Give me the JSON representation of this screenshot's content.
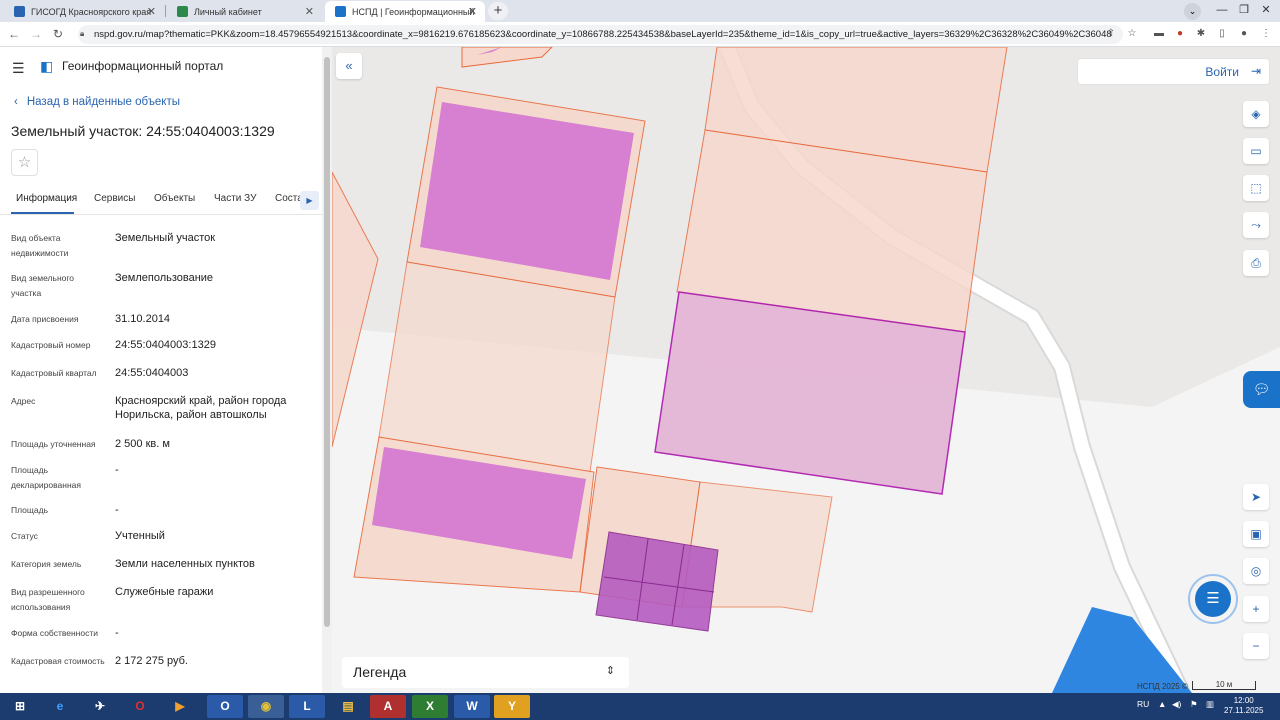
{
  "browser": {
    "tabs": [
      {
        "title": "ГИСОГД Красноярского края",
        "fav_color": "#2a64b0"
      },
      {
        "title": "Личный кабинет",
        "fav_color": "#2b8a4a"
      },
      {
        "title": "НСПД | Геоинформационный п...",
        "fav_color": "#1a73c8"
      }
    ],
    "url": "nspd.gov.ru/map?thematic=PKK&zoom=18.45796554921513&coordinate_x=9816219.676185623&coordinate_y=10866788.225434538&baseLayerId=235&theme_id=1&is_copy_url=true&active_layers=36329%2C36328%2C36049%2C36048"
  },
  "panel": {
    "portal_title": "Геоинформационный портал",
    "back_label": "Назад в найденные объекты",
    "object_title": "Земельный участок: 24:55:0404003:1329",
    "tabs": [
      "Информация",
      "Сервисы",
      "Объекты",
      "Части ЗУ",
      "Соста..."
    ],
    "rows": [
      {
        "label": "Вид объекта недвижимости",
        "value": "Земельный участок"
      },
      {
        "label": "Вид земельного участка",
        "value": "Землепользование"
      },
      {
        "label": "Дата присвоения",
        "value": "31.10.2014"
      },
      {
        "label": "Кадастровый номер",
        "value": "24:55:0404003:1329"
      },
      {
        "label": "Кадастровый квартал",
        "value": "24:55:0404003"
      },
      {
        "label": "Адрес",
        "value": "Красноярский край, район города Норильска, район автошколы"
      },
      {
        "label": "Площадь уточненная",
        "value": "2 500 кв. м"
      },
      {
        "label": "Площадь декларированная",
        "value": "-"
      },
      {
        "label": "Площадь",
        "value": "-"
      },
      {
        "label": "Статус",
        "value": "Учтенный"
      },
      {
        "label": "Категория земель",
        "value": "Земли населенных пунктов"
      },
      {
        "label": "Вид разрешенного использования",
        "value": "Служебные гаражи"
      },
      {
        "label": "Форма собственности",
        "value": "-"
      },
      {
        "label": "Кадастровая стоимость",
        "value": "2 172 275 руб."
      }
    ]
  },
  "map": {
    "login_label": "Войти",
    "legend_label": "Легенда",
    "copyright": "НСПД 2025 ©",
    "scale_label": "10 м",
    "colors": {
      "parcel_fill": "#f6d8cc",
      "parcel_stroke": "#e86a3c",
      "building_fill": "#d77fd0",
      "selected_fill": "#e4b6d6",
      "selected_stroke": "#b020b0",
      "road": "#ffffff",
      "water": "#2f86e0"
    }
  },
  "taskbar": {
    "lang": "RU",
    "time": "12:00",
    "date": "27.11.2025"
  }
}
